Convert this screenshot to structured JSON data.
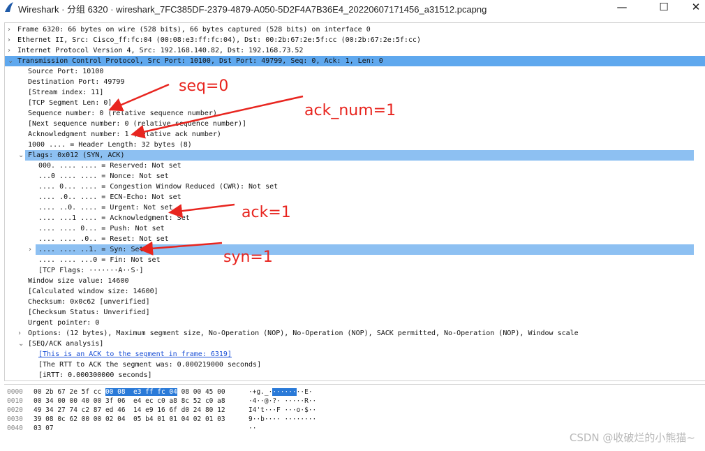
{
  "window": {
    "title": "Wireshark · 分组 6320 · wireshark_7FC385DF-2379-4879-A050-5D2F4A7B36E4_20220607171456_a31512.pcapng",
    "minimize": "—",
    "maximize": "☐",
    "close": "✕"
  },
  "tree": [
    {
      "text": "Frame 6320: 66 bytes on wire (528 bits), 66 bytes captured (528 bits) on interface 0",
      "indent": 0,
      "expander": "›"
    },
    {
      "text": "Ethernet II, Src: Cisco_ff:fc:04 (00:08:e3:ff:fc:04), Dst: 00:2b:67:2e:5f:cc (00:2b:67:2e:5f:cc)",
      "indent": 0,
      "expander": "›"
    },
    {
      "text": "Internet Protocol Version 4, Src: 192.168.140.82, Dst: 192.168.73.52",
      "indent": 0,
      "expander": "›"
    },
    {
      "text": "Transmission Control Protocol, Src Port: 10100, Dst Port: 49799, Seq: 0, Ack: 1, Len: 0",
      "indent": 0,
      "expander": "⌄",
      "selected": true
    },
    {
      "text": "Source Port: 10100",
      "indent": 1
    },
    {
      "text": "Destination Port: 49799",
      "indent": 1
    },
    {
      "text": "[Stream index: 11]",
      "indent": 1
    },
    {
      "text": "[TCP Segment Len: 0]",
      "indent": 1
    },
    {
      "text": "Sequence number: 0    (relative sequence number)",
      "indent": 1
    },
    {
      "text": "[Next sequence number: 0    (relative sequence number)]",
      "indent": 1
    },
    {
      "text": "Acknowledgment number: 1    (relative ack number)",
      "indent": 1
    },
    {
      "text": "1000 .... = Header Length: 32 bytes (8)",
      "indent": 1
    },
    {
      "text": "Flags: 0x012 (SYN, ACK)",
      "indent": 1,
      "expander": "⌄",
      "highlight": true
    },
    {
      "text": "000. .... .... = Reserved: Not set",
      "indent": 2
    },
    {
      "text": "...0 .... .... = Nonce: Not set",
      "indent": 2
    },
    {
      "text": ".... 0... .... = Congestion Window Reduced (CWR): Not set",
      "indent": 2
    },
    {
      "text": ".... .0.. .... = ECN-Echo: Not set",
      "indent": 2
    },
    {
      "text": ".... ..0. .... = Urgent: Not set",
      "indent": 2
    },
    {
      "text": ".... ...1 .... = Acknowledgment: Set",
      "indent": 2
    },
    {
      "text": ".... .... 0... = Push: Not set",
      "indent": 2
    },
    {
      "text": ".... .... .0.. = Reset: Not set",
      "indent": 2
    },
    {
      "text": ".... .... ..1. = Syn: Set",
      "indent": 2,
      "expander": "›",
      "highlight": true
    },
    {
      "text": ".... .... ...0 = Fin: Not set",
      "indent": 2
    },
    {
      "text": "[TCP Flags: ·······A··S·]",
      "indent": 2
    },
    {
      "text": "Window size value: 14600",
      "indent": 1
    },
    {
      "text": "[Calculated window size: 14600]",
      "indent": 1
    },
    {
      "text": "Checksum: 0x0c62 [unverified]",
      "indent": 1
    },
    {
      "text": "[Checksum Status: Unverified]",
      "indent": 1
    },
    {
      "text": "Urgent pointer: 0",
      "indent": 1
    },
    {
      "text": "Options: (12 bytes), Maximum segment size, No-Operation (NOP), No-Operation (NOP), SACK permitted, No-Operation (NOP), Window scale",
      "indent": 1,
      "expander": "›"
    },
    {
      "text": "[SEQ/ACK analysis]",
      "indent": 1,
      "expander": "⌄"
    },
    {
      "text": "[This is an ACK to the segment in frame: 6319]",
      "indent": 2,
      "link": true
    },
    {
      "text": "[The RTT to ACK the segment was: 0.000219000 seconds]",
      "indent": 2
    },
    {
      "text": "[iRTT: 0.000300000 seconds]",
      "indent": 2
    }
  ],
  "bytes": [
    {
      "offset": "0000",
      "hex_pre": "00 2b 67 2e 5f cc ",
      "hex_hl": "00 08  e3 ff fc 04",
      "hex_post": " 08 00 45 00",
      "ascii_pre": "·+g._·",
      "ascii_hl": "······",
      "ascii_post": "··E·"
    },
    {
      "offset": "0010",
      "hex_pre": "00 34 00 00 40 00 3f 06  e4 ec c0 a8 8c 52 c0 a8",
      "hex_hl": "",
      "hex_post": "",
      "ascii_pre": "·4··@·?· ·····R··",
      "ascii_hl": "",
      "ascii_post": ""
    },
    {
      "offset": "0020",
      "hex_pre": "49 34 27 74 c2 87 ed 46  14 e9 16 6f d0 24 80 12",
      "hex_hl": "",
      "hex_post": "",
      "ascii_pre": "I4't···F ···o·$··",
      "ascii_hl": "",
      "ascii_post": ""
    },
    {
      "offset": "0030",
      "hex_pre": "39 08 0c 62 00 00 02 04  05 b4 01 01 04 02 01 03",
      "hex_hl": "",
      "hex_post": "",
      "ascii_pre": "9··b···· ········",
      "ascii_hl": "",
      "ascii_post": ""
    },
    {
      "offset": "0040",
      "hex_pre": "03 07",
      "hex_hl": "",
      "hex_post": "",
      "ascii_pre": "··",
      "ascii_hl": "",
      "ascii_post": ""
    }
  ],
  "annotations": {
    "seq": "seq=0",
    "ack_num": "ack_num=1",
    "ack": "ack=1",
    "syn": "syn=1"
  },
  "watermark": "CSDN @收破烂的小熊猫~",
  "colors": {
    "selected": "#5fa8ee",
    "highlight": "#8dc0f2",
    "annotation": "#e8251f"
  }
}
